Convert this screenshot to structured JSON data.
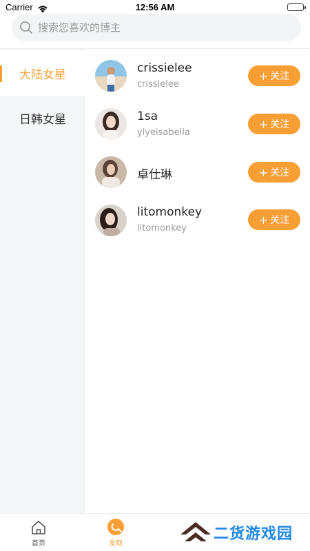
{
  "status_bar": {
    "carrier": "Carrier",
    "time": "12:56 AM"
  },
  "search": {
    "placeholder": "搜索您喜欢的博主"
  },
  "sidebar": {
    "items": [
      {
        "label": "大陆女星",
        "active": true
      },
      {
        "label": "日韩女星",
        "active": false
      }
    ]
  },
  "list": {
    "follow_label": "关注",
    "items": [
      {
        "name": "crissielee",
        "handle": "crissielee"
      },
      {
        "name": "1sa",
        "handle": "yiyeisabella"
      },
      {
        "name": "卓仕琳",
        "handle": ""
      },
      {
        "name": "litomonkey",
        "handle": "litomonkey"
      }
    ]
  },
  "tabbar": {
    "tabs": [
      {
        "label": "首页",
        "icon": "home-icon",
        "active": false
      },
      {
        "label": "发现",
        "icon": "discover-icon",
        "active": true
      }
    ]
  },
  "watermark": {
    "text": "二货游戏园"
  },
  "colors": {
    "accent": "#f79e35",
    "sidebar_bg": "#f5f6f8",
    "watermark_blue": "#1e88e5"
  }
}
